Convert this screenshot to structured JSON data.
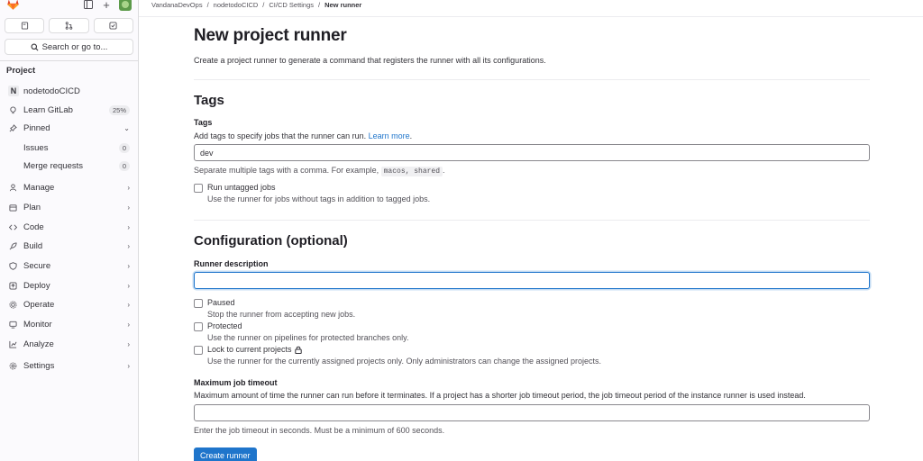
{
  "sidebar": {
    "section_title": "Project",
    "search_label": "Search or go to...",
    "project": {
      "initial": "N",
      "name": "nodetodoCICD"
    },
    "learn": {
      "label": "Learn GitLab",
      "badge": "25%"
    },
    "pinned": {
      "label": "Pinned"
    },
    "pinned_items": [
      {
        "label": "Issues",
        "count": "0"
      },
      {
        "label": "Merge requests",
        "count": "0"
      }
    ],
    "items": [
      {
        "label": "Manage",
        "icon": "users-icon"
      },
      {
        "label": "Plan",
        "icon": "calendar-icon"
      },
      {
        "label": "Code",
        "icon": "code-icon"
      },
      {
        "label": "Build",
        "icon": "rocket-icon"
      },
      {
        "label": "Secure",
        "icon": "shield-icon"
      },
      {
        "label": "Deploy",
        "icon": "deployments-icon"
      },
      {
        "label": "Operate",
        "icon": "cloud-gear-icon"
      },
      {
        "label": "Monitor",
        "icon": "monitor-icon"
      },
      {
        "label": "Analyze",
        "icon": "chart-icon"
      },
      {
        "label": "Settings",
        "icon": "gear-icon"
      }
    ]
  },
  "breadcrumb": {
    "items": [
      "VandanaDevOps",
      "nodetodoCICD",
      "CI/CD Settings"
    ],
    "current": "New runner",
    "separator": "/"
  },
  "page": {
    "title": "New project runner",
    "description": "Create a project runner to generate a command that registers the runner with all its configurations."
  },
  "tags_section": {
    "heading": "Tags",
    "label": "Tags",
    "help_text": "Add tags to specify jobs that the runner can run.",
    "learn_more": "Learn more",
    "period": ".",
    "value": "dev",
    "hint_prefix": "Separate multiple tags with a comma. For example,",
    "hint_code": "macos, shared",
    "hint_suffix": ".",
    "untagged": {
      "label": "Run untagged jobs",
      "help": "Use the runner for jobs without tags in addition to tagged jobs."
    }
  },
  "config_section": {
    "heading": "Configuration (optional)",
    "description_label": "Runner description",
    "description_value": "",
    "paused": {
      "label": "Paused",
      "help": "Stop the runner from accepting new jobs."
    },
    "protected": {
      "label": "Protected",
      "help": "Use the runner on pipelines for protected branches only."
    },
    "locked": {
      "label": "Lock to current projects",
      "help": "Use the runner for the currently assigned projects only. Only administrators can change the assigned projects."
    },
    "timeout_label": "Maximum job timeout",
    "timeout_help": "Maximum amount of time the runner can run before it terminates. If a project has a shorter job timeout period, the job timeout period of the instance runner is used instead.",
    "timeout_value": "",
    "timeout_hint": "Enter the job timeout in seconds. Must be a minimum of 600 seconds."
  },
  "submit_label": "Create runner",
  "colors": {
    "primary": "#1f75cb",
    "focus_ring": "#1f75cb",
    "tanuki": "#e24329"
  }
}
